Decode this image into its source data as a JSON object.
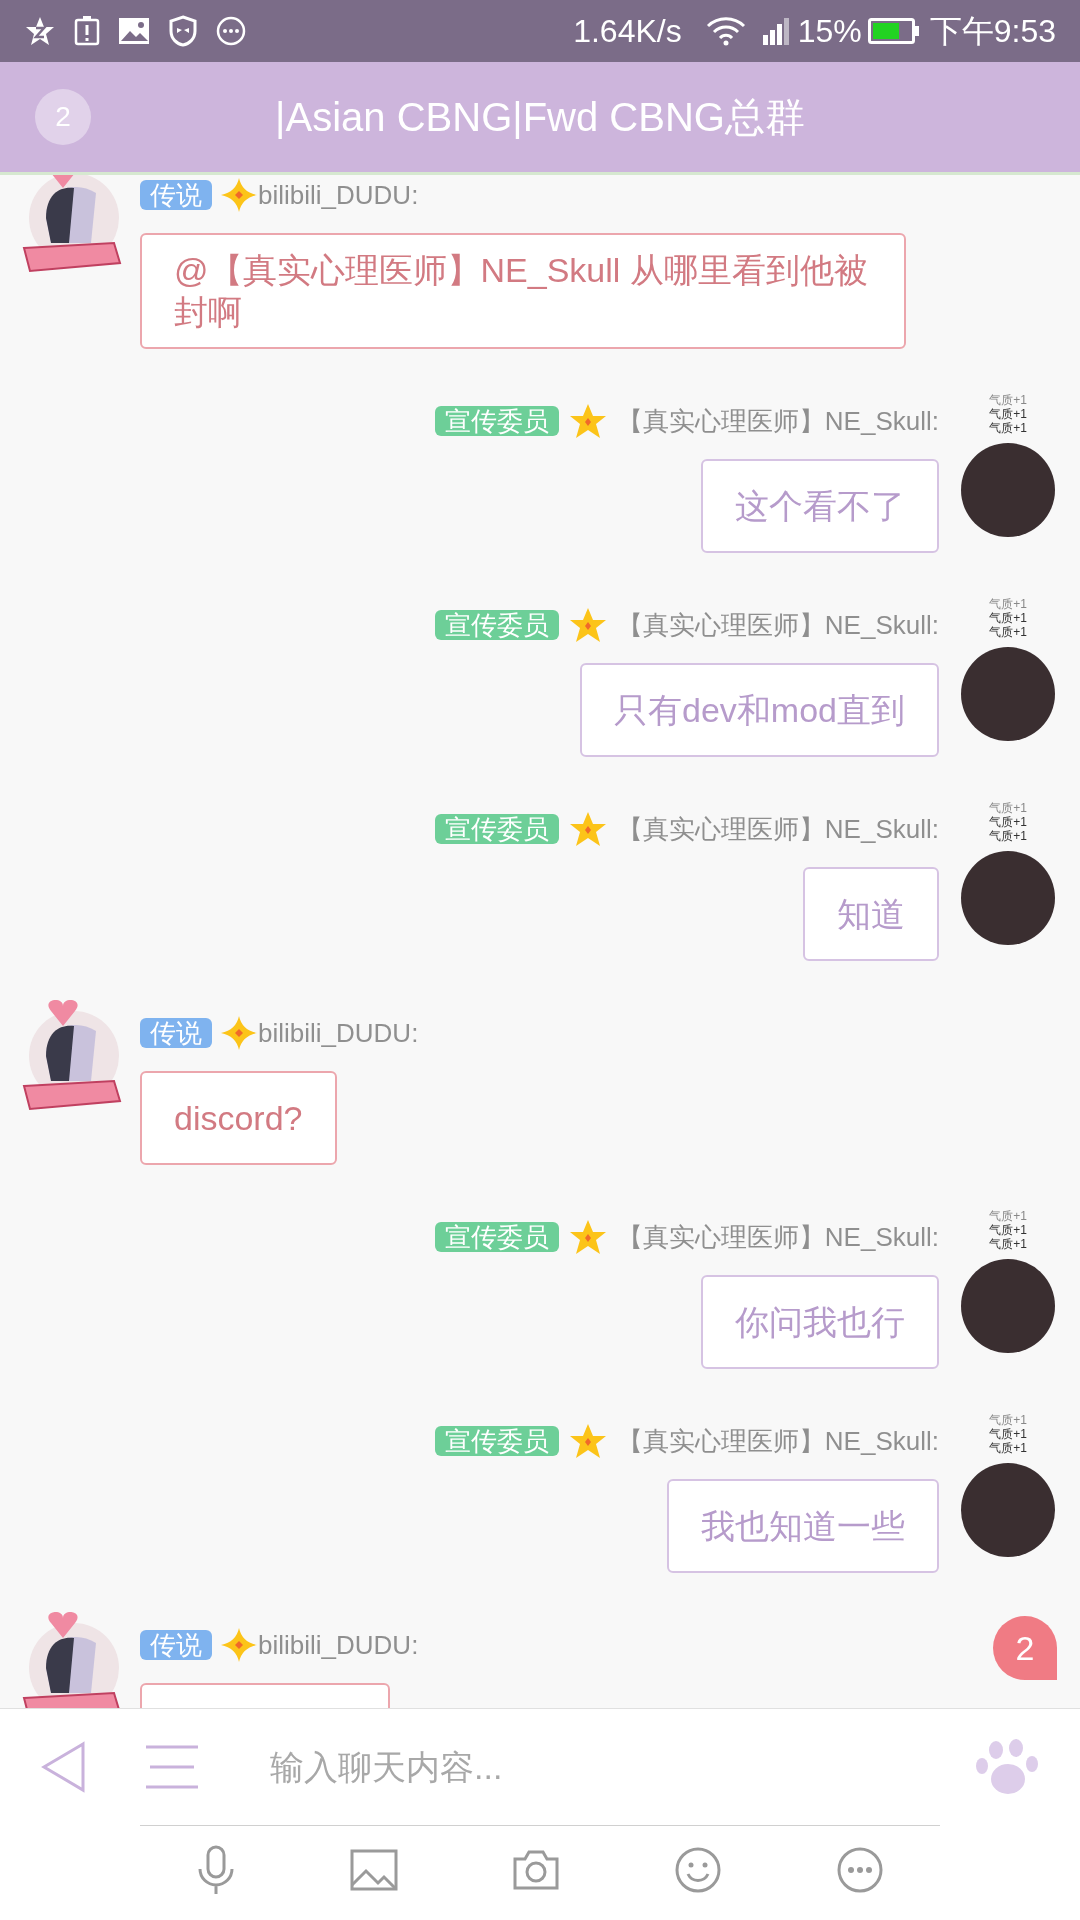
{
  "status_bar": {
    "network_speed": "1.64K/s",
    "battery_percent": "15%",
    "time": "下午9:53"
  },
  "header": {
    "unread_count": "2",
    "title": "|Asian CBNG|Fwd CBNG总群"
  },
  "messages": [
    {
      "kind": "left",
      "badge": "传说",
      "color": "#7fb3ef",
      "sender": "bilibili_DUDU:",
      "text": "@【真实心理医师】NE_Skull 从哪里看到他被封啊"
    },
    {
      "kind": "right",
      "badge": "宣传委员",
      "color": "#6dcf98",
      "sender": "【真实心理医师】NE_Skull:",
      "text": "这个看不了",
      "tags": [
        "气质+1",
        "气质+1",
        "气质+1"
      ]
    },
    {
      "kind": "right",
      "badge": "宣传委员",
      "color": "#6dcf98",
      "sender": "【真实心理医师】NE_Skull:",
      "text": "只有dev和mod直到",
      "tags": [
        "气质+1",
        "气质+1",
        "气质+1"
      ]
    },
    {
      "kind": "right",
      "badge": "宣传委员",
      "color": "#6dcf98",
      "sender": "【真实心理医师】NE_Skull:",
      "text": "知道",
      "tags": [
        "气质+1",
        "气质+1",
        "气质+1"
      ]
    },
    {
      "kind": "left",
      "badge": "传说",
      "color": "#7fb3ef",
      "sender": "bilibili_DUDU:",
      "text": "discord?"
    },
    {
      "kind": "right",
      "badge": "宣传委员",
      "color": "#6dcf98",
      "sender": "【真实心理医师】NE_Skull:",
      "text": "你问我也行",
      "tags": [
        "气质+1",
        "气质+1",
        "气质+1"
      ]
    },
    {
      "kind": "right",
      "badge": "宣传委员",
      "color": "#6dcf98",
      "sender": "【真实心理医师】NE_Skull:",
      "text": "我也知道一些",
      "tags": [
        "气质+1",
        "气质+1",
        "气质+1"
      ]
    },
    {
      "kind": "left",
      "badge": "传说",
      "color": "#7fb3ef",
      "sender": "bilibili_DUDU:"
    }
  ],
  "unread_bubble": "2",
  "input": {
    "placeholder": "输入聊天内容..."
  }
}
